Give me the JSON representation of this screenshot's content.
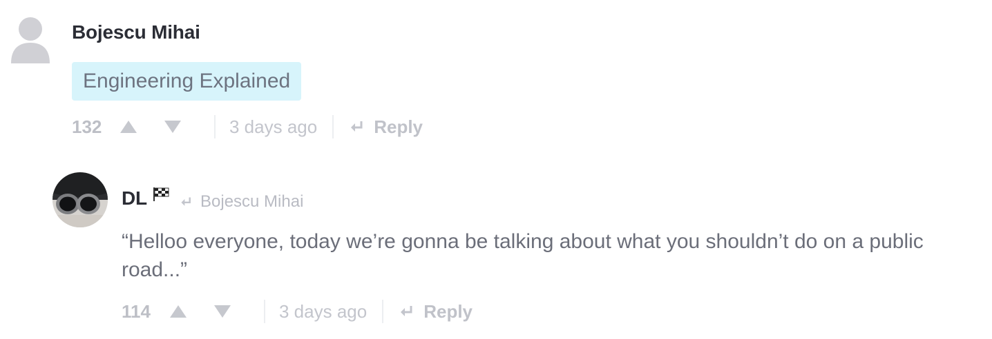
{
  "comments": [
    {
      "author": "Bojescu Mihai",
      "tag": "Engineering Explained",
      "votes": "132",
      "time": "3 days ago",
      "reply_label": "Reply",
      "avatar_icon": "default-user-icon"
    },
    {
      "author": "DL",
      "author_badge_icon": "checkered-flag-icon",
      "reply_to": "Bojescu Mihai",
      "body": "“Helloo everyone, today we’re gonna be talking about what you shouldn’t do on a public road...”",
      "votes": "114",
      "time": "3 days ago",
      "reply_label": "Reply",
      "avatar_icon": "exhaust-pipes-photo"
    }
  ],
  "colors": {
    "author": "#2b2d35",
    "body": "#6b6e79",
    "muted": "#c0c2c9",
    "tag_bg": "#d7f4fb"
  }
}
